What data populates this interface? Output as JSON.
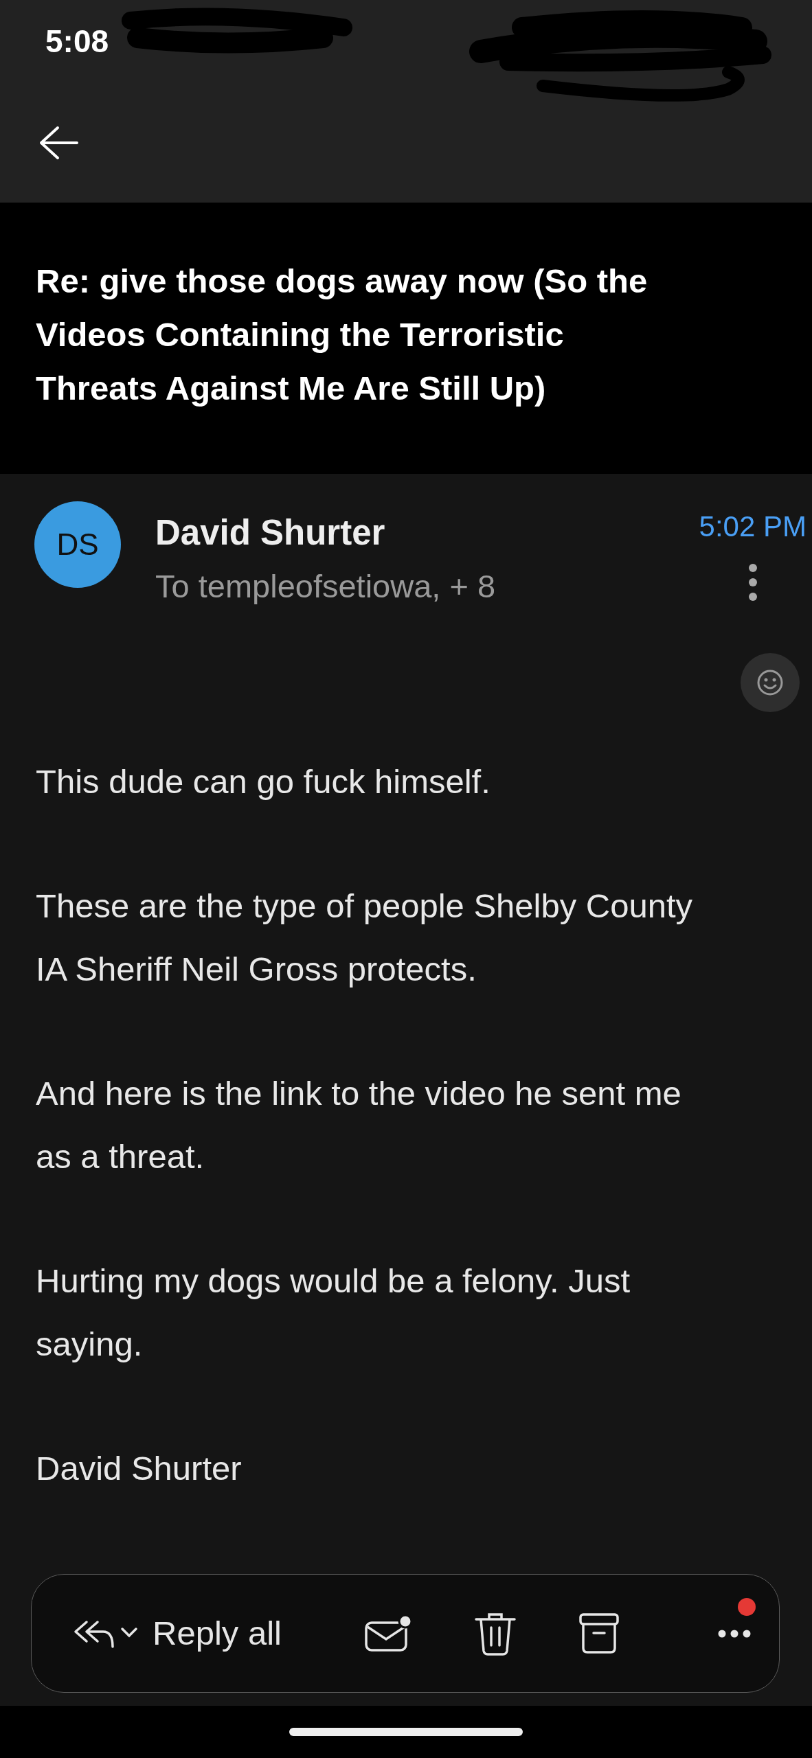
{
  "status_bar": {
    "time": "5:08"
  },
  "subject": "Re: give those dogs away now (So the Videos Containing the Terroristic Threats Against Me Are Still Up)",
  "message": {
    "avatar_initials": "DS",
    "sender": "David Shurter",
    "recipients": "To templeofsetiowa, + 8",
    "time": "5:02 PM"
  },
  "body": [
    "This dude can go fuck himself.",
    "These are the type of people Shelby County IA Sheriff Neil Gross protects.",
    "And here is the link to the video he sent me as a threat.",
    "Hurting my dogs would be a felony. Just saying.",
    "David Shurter"
  ],
  "toolbar": {
    "reply_label": "Reply all",
    "more_has_notification": true
  }
}
